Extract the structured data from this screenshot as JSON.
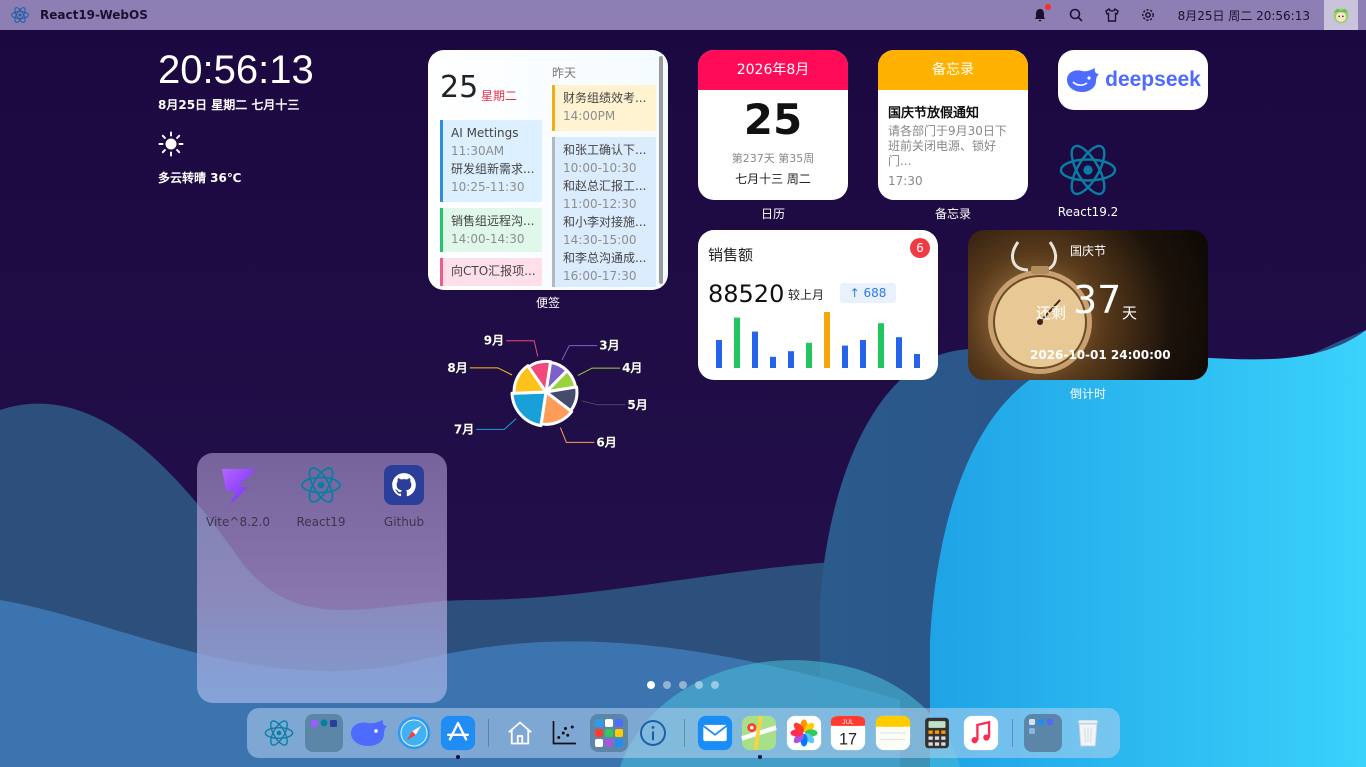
{
  "menubar": {
    "app_title": "React19-WebOS",
    "datetime": "8月25日 周二 20:56:13",
    "icons": [
      "notification-icon",
      "search-icon",
      "shirt-icon",
      "gear-icon",
      "avatar"
    ]
  },
  "clock": {
    "time": "20:56:13",
    "date": "8月25日 星期二 七月十三",
    "weather": "多云转晴 36℃"
  },
  "notes": {
    "day": "25",
    "weekday": "星期二",
    "yesterday_label": "昨天",
    "label": "便签",
    "left_cards": [
      {
        "color": "#2f8ee0",
        "bg": "#dcf0ff",
        "lines": [
          "AI Mettings",
          "11:30AM",
          "研发组新需求...",
          "10:25-11:30"
        ]
      },
      {
        "color": "#23c46c",
        "bg": "#dff8ea",
        "lines": [
          "销售组远程沟...",
          "14:00-14:30"
        ]
      },
      {
        "color": "#f25a8c",
        "bg": "#ffe0ea",
        "lines": [
          "向CTO汇报项..."
        ]
      }
    ],
    "right_cards": [
      {
        "color": "#f1ad12",
        "bg": "#fff3d2",
        "lines": [
          "财务组绩效考...",
          "14:00PM"
        ]
      },
      {
        "color": "#2f8ee0",
        "bg": "#dcecff",
        "lines": [
          "和张工确认下...",
          "10:00-10:30",
          "和赵总汇报工...",
          "11:00-12:30",
          "和小李对接施...",
          "14:30-15:00",
          "和李总沟通成...",
          "16:00-17:30"
        ]
      }
    ]
  },
  "calendar": {
    "header": "2026年8月",
    "day": "25",
    "info": "第237天 第35周",
    "lunar": "七月十三 周二",
    "label": "日历"
  },
  "memo": {
    "header": "备忘录",
    "title": "国庆节放假通知",
    "body": "请各部门于9月30日下班前关闭电源、锁好门...",
    "time": "17:30",
    "label": "备忘录"
  },
  "deepseek": {
    "text": "deepseek"
  },
  "react_icon": {
    "label": "React19.2"
  },
  "sales": {
    "title": "销售额",
    "badge": "6",
    "value": "88520",
    "compare": "较上月",
    "delta": "688",
    "bars": [
      {
        "value": 5,
        "color": "#2563eb"
      },
      {
        "value": 9,
        "color": "#22c55e"
      },
      {
        "value": 6.5,
        "color": "#2563eb"
      },
      {
        "value": 2,
        "color": "#2563eb"
      },
      {
        "value": 3,
        "color": "#2563eb"
      },
      {
        "value": 4.5,
        "color": "#22c55e"
      },
      {
        "value": 10,
        "color": "#f5a60a"
      },
      {
        "value": 4,
        "color": "#2563eb"
      },
      {
        "value": 5,
        "color": "#2563eb"
      },
      {
        "value": 8,
        "color": "#22c55e"
      },
      {
        "value": 5.5,
        "color": "#2563eb"
      },
      {
        "value": 2.5,
        "color": "#2563eb"
      }
    ]
  },
  "countdown": {
    "holiday": "国庆节",
    "remain": "还剩",
    "days": "37",
    "unit": "天",
    "target": "2026-10-01 24:00:00",
    "label": "倒计时"
  },
  "chart_data": {
    "type": "pie",
    "categories": [
      "3月",
      "4月",
      "5月",
      "6月",
      "7月",
      "8月",
      "9月"
    ],
    "values": [
      1,
      1,
      1.3,
      1.7,
      2.2,
      1.6,
      1.2
    ],
    "colors": [
      "#7b61c9",
      "#9bd23c",
      "#454c6b",
      "#ff9c5a",
      "#1aa0d8",
      "#ffc21a",
      "#ef4a7b"
    ]
  },
  "folder": {
    "apps": [
      {
        "label": "Vite^8.2.0",
        "icon": "vite-icon"
      },
      {
        "label": "React19",
        "icon": "react-icon"
      },
      {
        "label": "Github",
        "icon": "github-icon"
      }
    ]
  },
  "pager": {
    "pages": 5,
    "active": 0
  },
  "dock": {
    "items": [
      "react-icon",
      "folder-icon",
      "deepseek-icon",
      "safari-icon",
      "appstore-icon",
      "home-icon",
      "chart-icon",
      "apps-folder-icon",
      "info-icon",
      "mail-icon",
      "maps-icon",
      "photos-icon",
      "calendar-icon",
      "notes-icon",
      "calculator-icon",
      "music-icon",
      "launcher-icon",
      "trash-icon"
    ],
    "calendar_month": "JUL",
    "calendar_day": "17"
  },
  "colors": {
    "menubar": "#8d7fb3",
    "calendar_head": "#ff0b57",
    "memo_head": "#ffb100",
    "deepseek_blue": "#4d6bfe",
    "react_blue": "#087ea4"
  }
}
